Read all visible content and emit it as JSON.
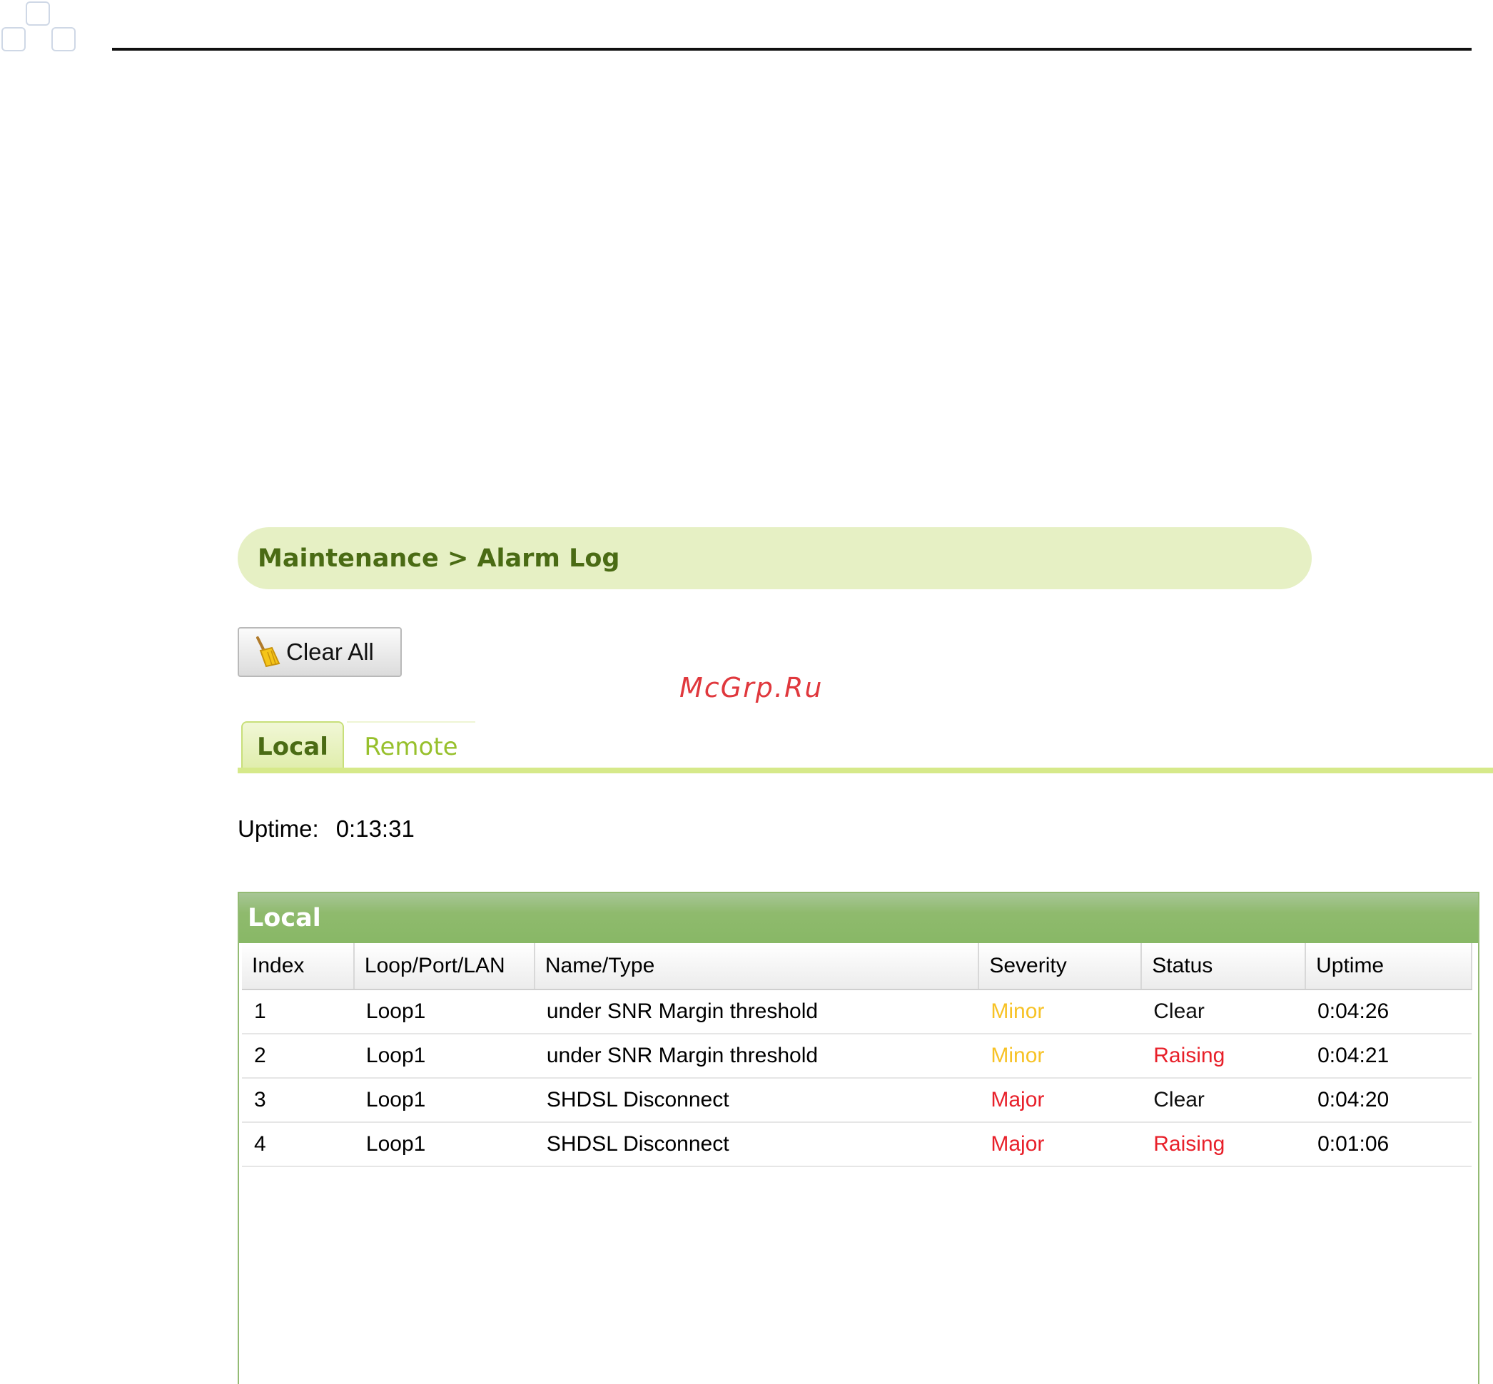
{
  "breadcrumb": {
    "text": "Maintenance > Alarm Log"
  },
  "toolbar": {
    "clear_all_label": "Clear All",
    "clear_all_icon": "broom-icon"
  },
  "watermark": "McGrp.Ru",
  "tabs": [
    {
      "label": "Local",
      "active": true
    },
    {
      "label": "Remote",
      "active": false
    }
  ],
  "uptime": {
    "label": "Uptime:",
    "value": "0:13:31"
  },
  "panel": {
    "title": "Local"
  },
  "table": {
    "columns": [
      "Index",
      "Loop/Port/LAN",
      "Name/Type",
      "Severity",
      "Status",
      "Uptime"
    ],
    "rows": [
      {
        "index": "1",
        "loop": "Loop1",
        "name": "under SNR Margin threshold",
        "severity": "Minor",
        "status": "Clear",
        "uptime": "0:04:26"
      },
      {
        "index": "2",
        "loop": "Loop1",
        "name": "under SNR Margin threshold",
        "severity": "Minor",
        "status": "Raising",
        "uptime": "0:04:21"
      },
      {
        "index": "3",
        "loop": "Loop1",
        "name": "SHDSL Disconnect",
        "severity": "Major",
        "status": "Clear",
        "uptime": "0:04:20"
      },
      {
        "index": "4",
        "loop": "Loop1",
        "name": "SHDSL Disconnect",
        "severity": "Major",
        "status": "Raising",
        "uptime": "0:01:06"
      }
    ]
  },
  "colors": {
    "accent": "#4a6b14",
    "breadcrumb_bg": "#e6f0c4",
    "panel_header": "#8fba6d",
    "minor": "#f7c225",
    "major": "#e8202a"
  }
}
